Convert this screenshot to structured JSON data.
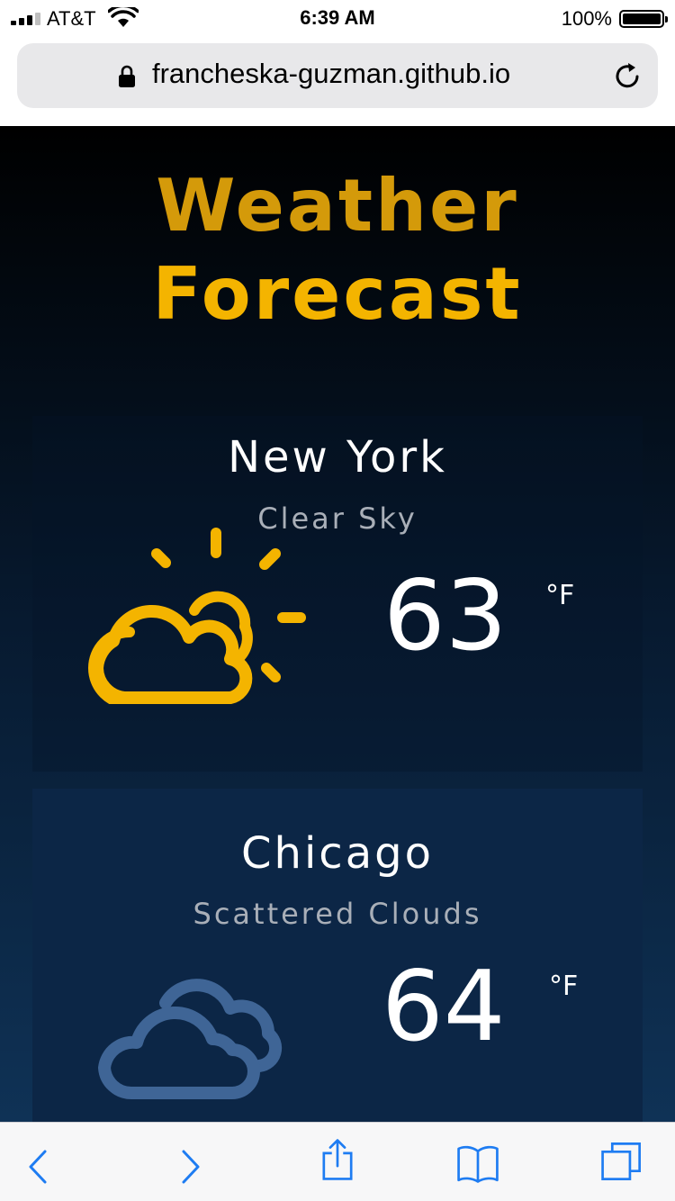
{
  "status_bar": {
    "carrier": "AT&T",
    "time": "6:39 AM",
    "battery_percent": "100%",
    "signal_bars": 4,
    "signal_strength": 3
  },
  "browser": {
    "url": "francheska-guzman.github.io",
    "secure": true
  },
  "page": {
    "title_line1": "Weather",
    "title_line2": "Forecast"
  },
  "forecasts": [
    {
      "city": "New York",
      "description": "Clear Sky",
      "temperature": "63",
      "unit": "°F",
      "icon": "partly-sunny-icon",
      "icon_color": "#f4b400"
    },
    {
      "city": "Chicago",
      "description": "Scattered Clouds",
      "temperature": "64",
      "unit": "°F",
      "icon": "clouds-icon",
      "icon_color": "#3f6596"
    }
  ],
  "toolbar": {
    "items": [
      "back-icon",
      "forward-icon",
      "share-icon",
      "bookmarks-icon",
      "tabs-icon"
    ],
    "accent_color": "#1e7cf2"
  },
  "colors": {
    "title_primary": "#f4b400",
    "background_top": "#000000",
    "background_bottom": "#0f3256"
  }
}
